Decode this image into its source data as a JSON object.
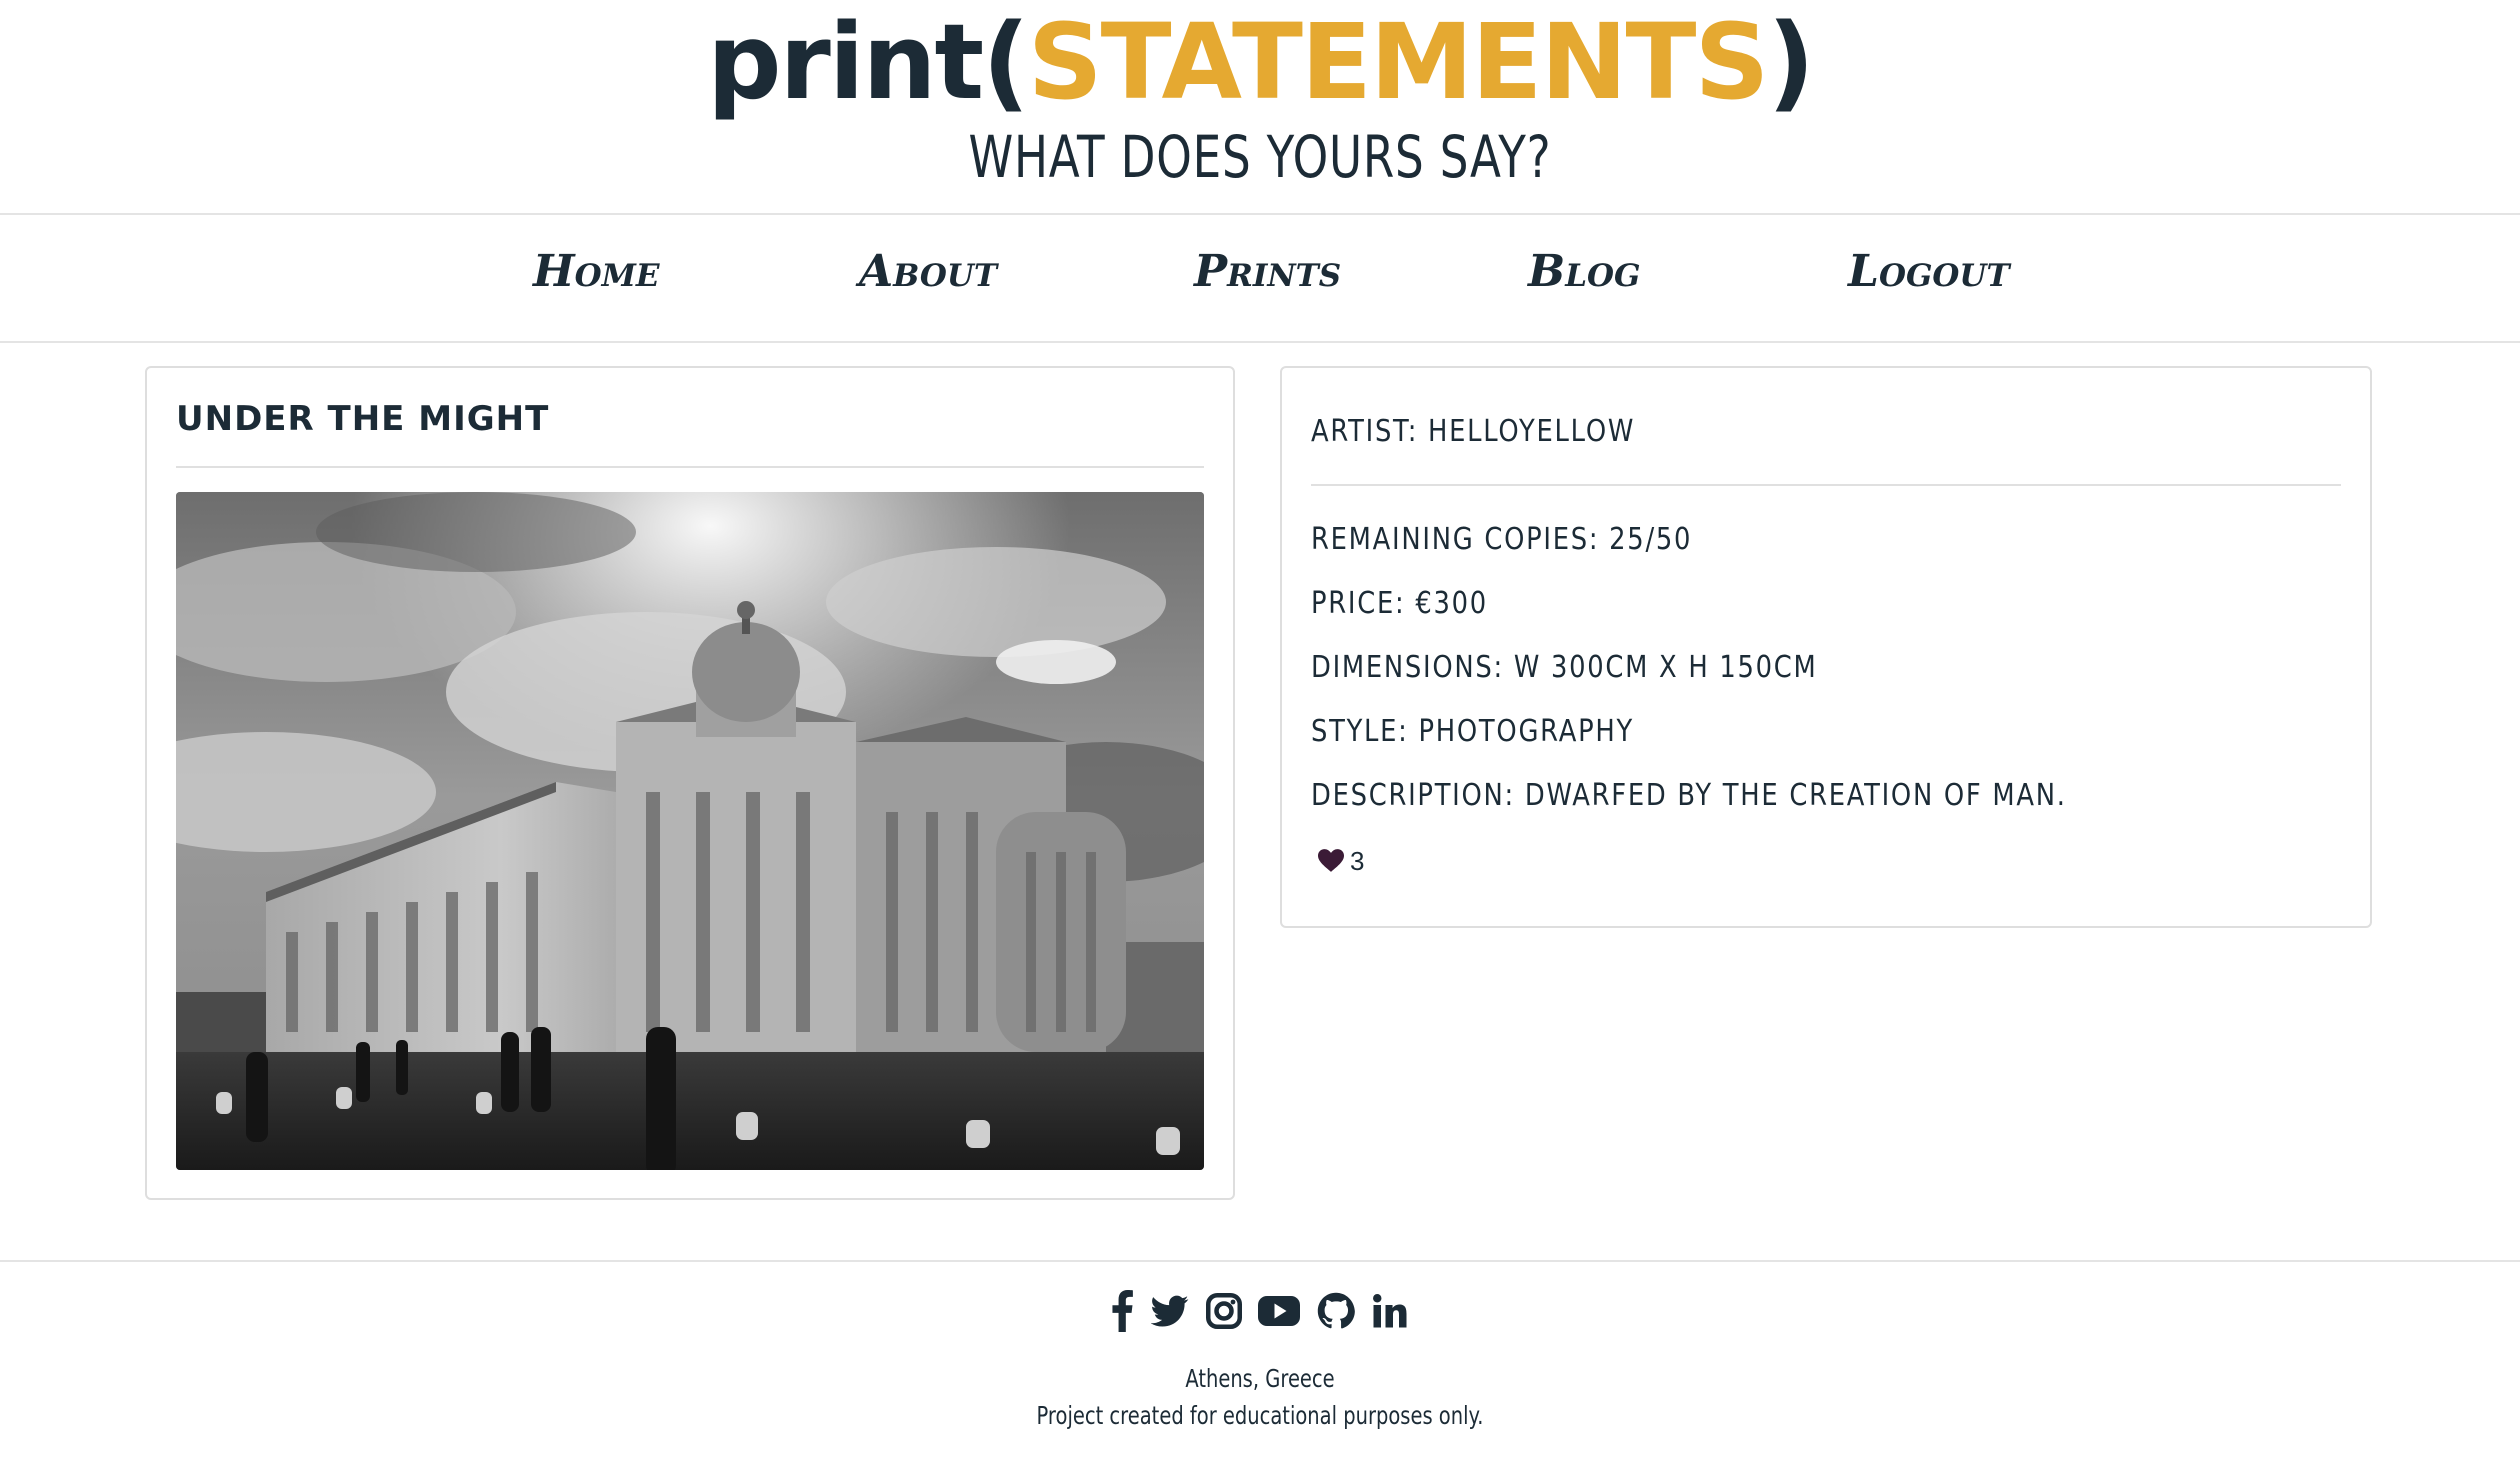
{
  "header": {
    "logo_prefix": "print(",
    "logo_accent": "STATEMENTS",
    "logo_suffix": ")",
    "tagline": "WHAT DOES YOURS SAY?"
  },
  "nav": {
    "items": [
      {
        "label": "Home"
      },
      {
        "label": "About"
      },
      {
        "label": "Prints"
      },
      {
        "label": "Blog"
      },
      {
        "label": "Logout"
      }
    ]
  },
  "print": {
    "title": "UNDER THE MIGHT",
    "image_alt": "Black and white photograph of a cathedral under a cloudy sky"
  },
  "details": {
    "artist": "ARTIST: HELLOYELLOW",
    "remaining": "REMAINING COPIES: 25/50",
    "price": "PRICE: €300",
    "dimensions": "DIMENSIONS: W 300CM X H 150CM",
    "style": "STYLE: PHOTOGRAPHY",
    "description": "DESCRIPTION: DWARFED BY THE CREATION OF MAN.",
    "likes": "3"
  },
  "footer": {
    "social": [
      "facebook-icon",
      "twitter-icon",
      "instagram-icon",
      "youtube-icon",
      "github-icon",
      "linkedin-icon"
    ],
    "location": "Athens, Greece",
    "note": "Project created for educational purposes only."
  },
  "colors": {
    "primary": "#1c2b36",
    "accent": "#e5a931",
    "heart": "#3b1b36",
    "border": "#dedede"
  }
}
